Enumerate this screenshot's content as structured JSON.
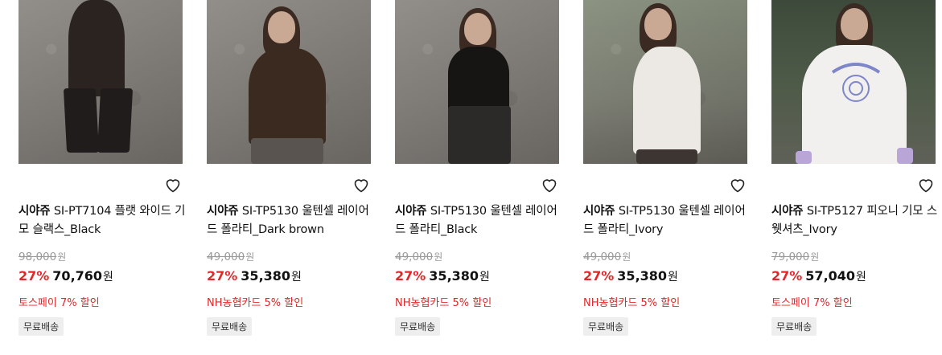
{
  "products": [
    {
      "brand": "시야쥬",
      "name": "SI-PT7104 플랫 와이드 기모 슬랙스_Black",
      "original_price": "98,000",
      "currency": "원",
      "discount": "27%",
      "sale_price": "70,760",
      "promo": "토스페이 7% 할인",
      "badge": "무료배송",
      "image_icon": "product-photo-slacks-black"
    },
    {
      "brand": "시야쥬",
      "name": "SI-TP5130 울텐셀 레이어드 폴라티_Dark brown",
      "original_price": "49,000",
      "currency": "원",
      "discount": "27%",
      "sale_price": "35,380",
      "promo": "NH농협카드 5% 할인",
      "badge": "무료배송",
      "image_icon": "product-photo-turtleneck-brown"
    },
    {
      "brand": "시야쥬",
      "name": "SI-TP5130 울텐셀 레이어드 폴라티_Black",
      "original_price": "49,000",
      "currency": "원",
      "discount": "27%",
      "sale_price": "35,380",
      "promo": "NH농협카드 5% 할인",
      "badge": "무료배송",
      "image_icon": "product-photo-turtleneck-black"
    },
    {
      "brand": "시야쥬",
      "name": "SI-TP5130 울텐셀 레이어드 폴라티_Ivory",
      "original_price": "49,000",
      "currency": "원",
      "discount": "27%",
      "sale_price": "35,380",
      "promo": "NH농협카드 5% 할인",
      "badge": "무료배송",
      "image_icon": "product-photo-turtleneck-ivory"
    },
    {
      "brand": "시야쥬",
      "name": "SI-TP5127 피오니 기모 스웻셔츠_Ivory",
      "original_price": "79,000",
      "currency": "원",
      "discount": "27%",
      "sale_price": "57,040",
      "promo": "토스페이 7% 할인",
      "badge": "무료배송",
      "image_icon": "product-photo-sweatshirt-ivory"
    }
  ],
  "colors": {
    "discount": "#e0282a",
    "promo": "#e0282a",
    "original_price": "#9a9a9a",
    "badge_bg": "#eeeeee"
  }
}
